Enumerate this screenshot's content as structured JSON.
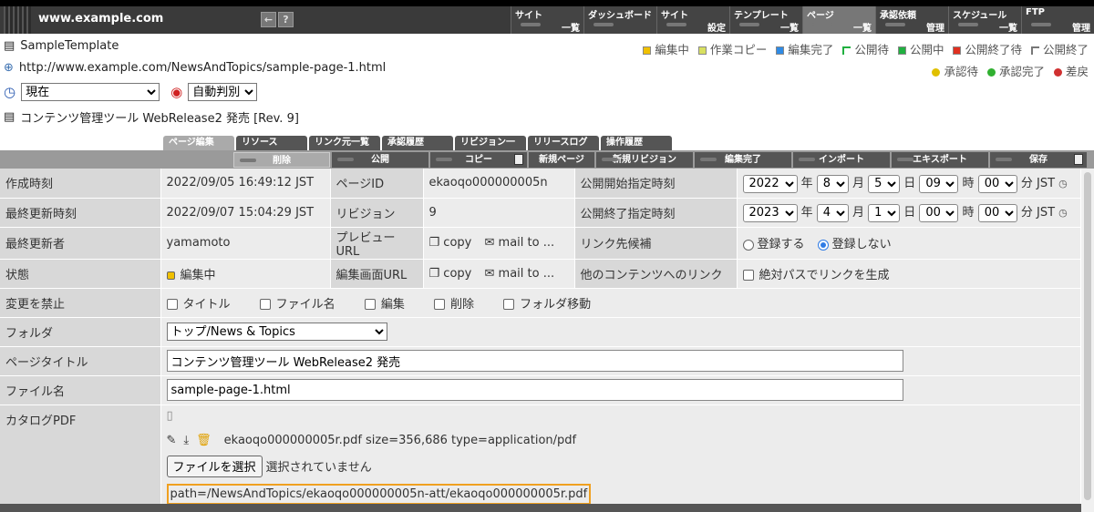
{
  "app": {
    "site_url": "www.example.com"
  },
  "nav": [
    {
      "t": "サイト",
      "b": "一覧"
    },
    {
      "t": "ダッシュボード",
      "b": ""
    },
    {
      "t": "サイト",
      "b": "設定"
    },
    {
      "t": "テンプレート",
      "b": "一覧"
    },
    {
      "t": "ページ",
      "b": "一覧"
    },
    {
      "t": "承認依頼",
      "b": "管理"
    },
    {
      "t": "スケジュール",
      "b": "一覧"
    },
    {
      "t": "FTP",
      "b": "管理"
    }
  ],
  "header": {
    "template": "SampleTemplate",
    "url": "http://www.example.com/NewsAndTopics/sample-page-1.html",
    "time_select": "現在",
    "auto_select": "自動判別",
    "title_line": "コンテンツ管理ツール WebRelease2 発売 [Rev. 9]"
  },
  "legend1": [
    {
      "label": "編集中",
      "color": "#f0c000"
    },
    {
      "label": "作業コピー",
      "color": "#d8e060"
    },
    {
      "label": "編集完了",
      "color": "#2f8be5"
    },
    {
      "label": "公開待",
      "color": "#ffffff"
    },
    {
      "label": "公開中",
      "color": "#20b040"
    },
    {
      "label": "公開終了待",
      "color": "#e03020"
    },
    {
      "label": "公開終了",
      "color": "#ffffff"
    }
  ],
  "legend2": [
    {
      "label": "承認待",
      "color": "#e0c000"
    },
    {
      "label": "承認完了",
      "color": "#30b030"
    },
    {
      "label": "差戻",
      "color": "#d03030"
    }
  ],
  "tabs": [
    "ページ編集",
    "リソース",
    "リンク元一覧",
    "承認履歴",
    "リビジョン一覧",
    "リリースログ",
    "操作履歴"
  ],
  "actions": [
    "削除",
    "公開",
    "コピー",
    "新規ページ",
    "新規リビジョン",
    "編集完了",
    "インポート",
    "エキスポート",
    "保存"
  ],
  "form": {
    "created_label": "作成時刻",
    "created": "2022/09/05 16:49:12 JST",
    "pageid_label": "ページID",
    "pageid": "ekaoqo000000005n",
    "pub_start_label": "公開開始指定時刻",
    "start": {
      "year": "2022",
      "month": "8",
      "day": "5",
      "hour": "09",
      "min": "00"
    },
    "updated_label": "最終更新時刻",
    "updated": "2022/09/07 15:04:29 JST",
    "rev_label": "リビジョン",
    "rev": "9",
    "pub_end_label": "公開終了指定時刻",
    "end": {
      "year": "2023",
      "month": "4",
      "day": "1",
      "hour": "00",
      "min": "00"
    },
    "unit_year": "年",
    "unit_month": "月",
    "unit_day": "日",
    "unit_hour": "時",
    "unit_min": "分",
    "tz": "JST",
    "updater_label": "最終更新者",
    "updater": "yamamoto",
    "preview_label": "プレビューURL",
    "copy": "copy",
    "mailto": "mail to ...",
    "linkcand_label": "リンク先候補",
    "reg_yes": "登録する",
    "reg_no": "登録しない",
    "state_label": "状態",
    "state": "編集中",
    "editurl_label": "編集画面URL",
    "otherlink_label": "他のコンテンツへのリンク",
    "abs_path": "絶対パスでリンクを生成",
    "lock_label": "変更を禁止",
    "lock_opts": [
      "タイトル",
      "ファイル名",
      "編集",
      "削除",
      "フォルダ移動"
    ],
    "folder_label": "フォルダ",
    "folder": "トップ/News & Topics",
    "title_label": "ページタイトル",
    "title": "コンテンツ管理ツール WebRelease2 発売",
    "filename_label": "ファイル名",
    "filename": "sample-page-1.html",
    "pdf_label": "カタログPDF",
    "pdf_info": "ekaoqo000000005r.pdf size=356,686 type=application/pdf",
    "choose_file": "ファイルを選択",
    "no_file": "選択されていません",
    "pdf_path": "path=/NewsAndTopics/ekaoqo000000005n-att/ekaoqo000000005r.pdf"
  }
}
